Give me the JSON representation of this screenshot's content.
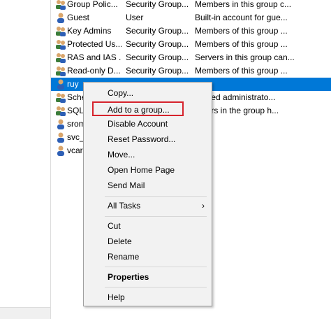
{
  "list": {
    "rows": [
      {
        "name": "Group Polic...",
        "type": "Security Group...",
        "desc": "Members in this group c...",
        "icon": "group-icon"
      },
      {
        "name": "Guest",
        "type": "User",
        "desc": "Built-in account for gue...",
        "icon": "user-icon"
      },
      {
        "name": "Key Admins",
        "type": "Security Group...",
        "desc": "Members of this group ...",
        "icon": "group-icon"
      },
      {
        "name": "Protected Us...",
        "type": "Security Group...",
        "desc": "Members of this group ...",
        "icon": "group-icon"
      },
      {
        "name": "RAS and IAS ...",
        "type": "Security Group...",
        "desc": "Servers in this group can...",
        "icon": "group-icon"
      },
      {
        "name": "Read-only D...",
        "type": "Security Group...",
        "desc": "Members of this group ...",
        "icon": "group-icon"
      },
      {
        "name": "ruy",
        "type": "",
        "desc": "",
        "icon": "user-icon"
      },
      {
        "name": "Sche",
        "type": "",
        "desc": "gnated administrato...",
        "icon": "group-icon"
      },
      {
        "name": "SQLS",
        "type": "",
        "desc": "mbers in the group h...",
        "icon": "group-icon"
      },
      {
        "name": "srom",
        "type": "",
        "desc": "",
        "icon": "user-icon"
      },
      {
        "name": "svc_",
        "type": "",
        "desc": "",
        "icon": "user-icon"
      },
      {
        "name": "vcar",
        "type": "",
        "desc": "",
        "icon": "user-icon"
      }
    ]
  },
  "context_menu": {
    "items": [
      {
        "label": "Copy..."
      },
      {
        "label": "Add to a group..."
      },
      {
        "label": "Disable Account"
      },
      {
        "label": "Reset Password..."
      },
      {
        "label": "Move..."
      },
      {
        "label": "Open Home Page"
      },
      {
        "label": "Send Mail"
      },
      {
        "label": "All Tasks",
        "submenu_arrow": "›"
      },
      {
        "label": "Cut"
      },
      {
        "label": "Delete"
      },
      {
        "label": "Rename"
      },
      {
        "label": "Properties"
      },
      {
        "label": "Help"
      }
    ]
  },
  "colors": {
    "selection": "#0078d7",
    "highlight_box": "#d6232c",
    "menu_background": "#f2f2f2"
  }
}
